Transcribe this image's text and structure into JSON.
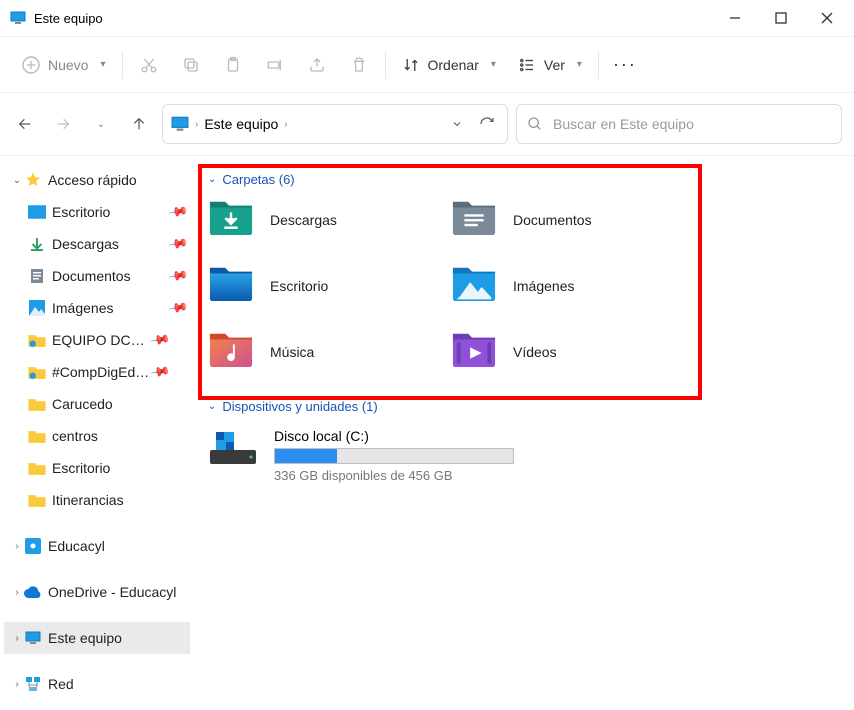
{
  "window": {
    "title": "Este equipo"
  },
  "toolbar": {
    "new_label": "Nuevo",
    "sort_label": "Ordenar",
    "view_label": "Ver"
  },
  "breadcrumb": {
    "root": "Este equipo"
  },
  "search": {
    "placeholder": "Buscar en Este equipo"
  },
  "sidebar": {
    "quick_access": "Acceso rápido",
    "items": [
      {
        "label": "Escritorio"
      },
      {
        "label": "Descargas"
      },
      {
        "label": "Documentos"
      },
      {
        "label": "Imágenes"
      },
      {
        "label": "EQUIPO DCD #CompDigEdu"
      },
      {
        "label": "#CompDigEdu Avila"
      },
      {
        "label": "Carucedo"
      },
      {
        "label": "centros"
      },
      {
        "label": "Escritorio"
      },
      {
        "label": "Itinerancias"
      }
    ],
    "educacyl": "Educacyl",
    "onedrive": "OneDrive - Educacyl",
    "este_equipo": "Este equipo",
    "red": "Red"
  },
  "groups": {
    "folders_header": "Carpetas (6)",
    "folders": [
      {
        "label": "Descargas"
      },
      {
        "label": "Documentos"
      },
      {
        "label": "Escritorio"
      },
      {
        "label": "Imágenes"
      },
      {
        "label": "Música"
      },
      {
        "label": "Vídeos"
      }
    ],
    "devices_header": "Dispositivos y unidades (1)",
    "drive": {
      "name": "Disco local (C:)",
      "subtitle": "336 GB disponibles de 456 GB",
      "fill_percent": 26
    }
  }
}
